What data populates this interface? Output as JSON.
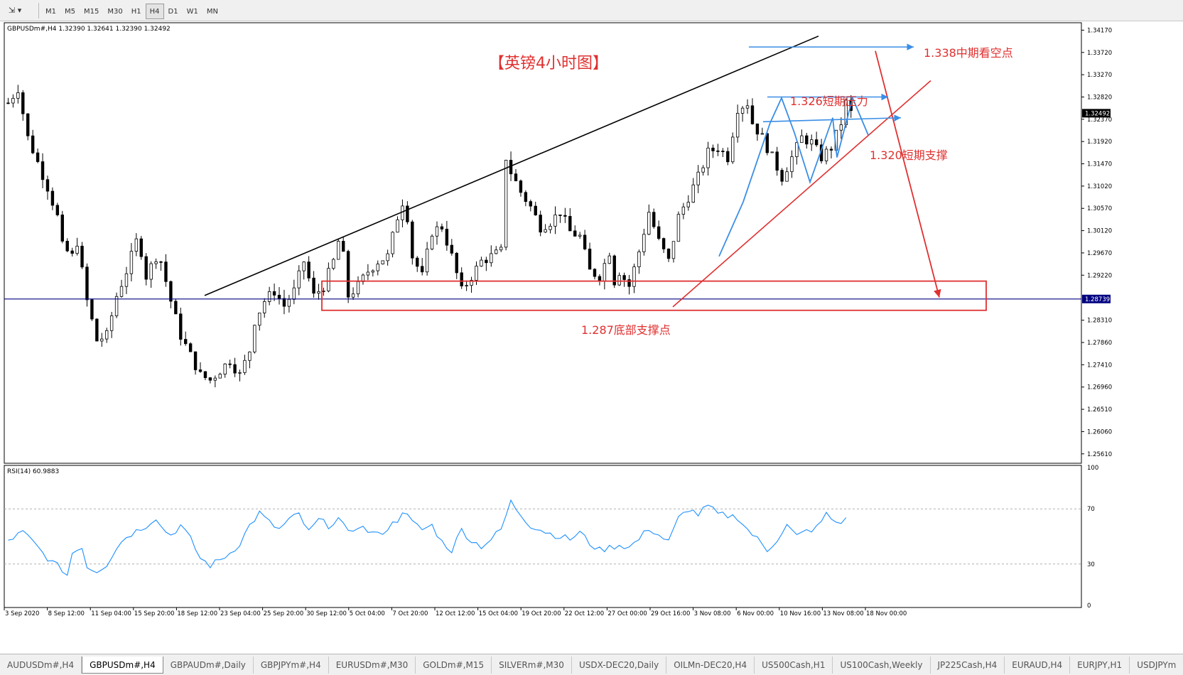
{
  "toolbar": {
    "timeframes": [
      "M1",
      "M5",
      "M15",
      "M30",
      "H1",
      "H4",
      "D1",
      "W1",
      "MN"
    ],
    "active_timeframe": "H4"
  },
  "main_header": "GBPUSDm#,H4  1.32390 1.32641 1.32390 1.32492",
  "rsi_header": "RSI(14) 60.9883",
  "chart_data": {
    "type": "candlestick",
    "symbol": "GBPUSDm#",
    "timeframe": "H4",
    "ohlc_header": {
      "open": 1.3239,
      "high": 1.32641,
      "low": 1.3239,
      "close": 1.32492
    },
    "y_ticks": [
      "1.34170",
      "1.33720",
      "1.33270",
      "1.32820",
      "1.32370",
      "1.31920",
      "1.31470",
      "1.31020",
      "1.30570",
      "1.30120",
      "1.29670",
      "1.29220",
      "1.28310",
      "1.27860",
      "1.27410",
      "1.26960",
      "1.26510",
      "1.26060",
      "1.25610"
    ],
    "ylim": [
      1.2542,
      1.3432
    ],
    "current_price_label": "1.32492",
    "hline_label": "1.28739",
    "hline_value": 1.28739,
    "x_labels": [
      "3 Sep 2020",
      "8 Sep 12:00",
      "11 Sep 04:00",
      "15 Sep 20:00",
      "18 Sep 12:00",
      "23 Sep 04:00",
      "25 Sep 20:00",
      "30 Sep 12:00",
      "5 Oct 04:00",
      "7 Oct 20:00",
      "12 Oct 12:00",
      "15 Oct 04:00",
      "19 Oct 20:00",
      "22 Oct 12:00",
      "27 Oct 00:00",
      "29 Oct 16:00",
      "3 Nov 08:00",
      "6 Nov 00:00",
      "10 Nov 16:00",
      "13 Nov 08:00",
      "18 Nov 00:00"
    ],
    "close_path": [
      [
        0,
        1.327
      ],
      [
        2,
        1.33
      ],
      [
        4,
        1.32
      ],
      [
        6,
        1.315
      ],
      [
        8,
        1.31
      ],
      [
        10,
        1.304
      ],
      [
        11,
        1.298
      ],
      [
        13,
        1.296
      ],
      [
        14,
        1.299
      ],
      [
        16,
        1.287
      ],
      [
        18,
        1.279
      ],
      [
        20,
        1.28
      ],
      [
        22,
        1.288
      ],
      [
        24,
        1.293
      ],
      [
        26,
        1.299
      ],
      [
        27,
        1.297
      ],
      [
        28,
        1.292
      ],
      [
        30,
        1.296
      ],
      [
        31,
        1.295
      ],
      [
        33,
        1.287
      ],
      [
        35,
        1.28
      ],
      [
        37,
        1.276
      ],
      [
        39,
        1.272
      ],
      [
        41,
        1.271
      ],
      [
        43,
        1.273
      ],
      [
        45,
        1.275
      ],
      [
        47,
        1.272
      ],
      [
        49,
        1.277
      ],
      [
        50,
        1.283
      ],
      [
        52,
        1.287
      ],
      [
        54,
        1.289
      ],
      [
        56,
        1.286
      ],
      [
        58,
        1.289
      ],
      [
        60,
        1.295
      ],
      [
        62,
        1.288
      ],
      [
        64,
        1.29
      ],
      [
        66,
        1.295
      ],
      [
        67,
        1.299
      ],
      [
        68,
        1.296
      ],
      [
        69,
        1.288
      ],
      [
        71,
        1.29
      ],
      [
        73,
        1.293
      ],
      [
        75,
        1.295
      ],
      [
        77,
        1.296
      ],
      [
        79,
        1.304
      ],
      [
        80,
        1.307
      ],
      [
        81,
        1.304
      ],
      [
        82,
        1.296
      ],
      [
        84,
        1.292
      ],
      [
        86,
        1.301
      ],
      [
        88,
        1.302
      ],
      [
        90,
        1.296
      ],
      [
        92,
        1.289
      ],
      [
        94,
        1.292
      ],
      [
        96,
        1.295
      ],
      [
        98,
        1.296
      ],
      [
        100,
        1.297
      ],
      [
        101,
        1.316
      ],
      [
        102,
        1.313
      ],
      [
        104,
        1.309
      ],
      [
        106,
        1.306
      ],
      [
        108,
        1.302
      ],
      [
        110,
        1.303
      ],
      [
        112,
        1.305
      ],
      [
        114,
        1.301
      ],
      [
        116,
        1.3
      ],
      [
        118,
        1.293
      ],
      [
        120,
        1.292
      ],
      [
        122,
        1.297
      ],
      [
        123,
        1.291
      ],
      [
        124,
        1.293
      ],
      [
        126,
        1.29
      ],
      [
        128,
        1.297
      ],
      [
        130,
        1.305
      ],
      [
        132,
        1.299
      ],
      [
        134,
        1.295
      ],
      [
        136,
        1.304
      ],
      [
        138,
        1.308
      ],
      [
        140,
        1.312
      ],
      [
        142,
        1.317
      ],
      [
        144,
        1.318
      ],
      [
        146,
        1.316
      ],
      [
        148,
        1.326
      ],
      [
        150,
        1.327
      ],
      [
        151,
        1.323
      ],
      [
        153,
        1.32
      ],
      [
        155,
        1.316
      ],
      [
        157,
        1.312
      ],
      [
        159,
        1.316
      ],
      [
        161,
        1.32
      ],
      [
        163,
        1.319
      ],
      [
        165,
        1.316
      ],
      [
        167,
        1.318
      ],
      [
        169,
        1.323
      ],
      [
        170,
        1.327
      ],
      [
        171,
        1.325
      ]
    ],
    "rsi": {
      "label": "RSI(14)",
      "value": 60.9883,
      "levels": [
        30,
        70
      ],
      "y_ticks": [
        "100",
        "70",
        "30",
        "0"
      ],
      "path": [
        [
          0,
          47
        ],
        [
          3,
          53
        ],
        [
          5,
          46
        ],
        [
          7,
          38
        ],
        [
          9,
          31
        ],
        [
          11,
          26
        ],
        [
          12,
          22
        ],
        [
          13,
          38
        ],
        [
          15,
          43
        ],
        [
          16,
          28
        ],
        [
          18,
          25
        ],
        [
          20,
          30
        ],
        [
          22,
          42
        ],
        [
          24,
          50
        ],
        [
          26,
          54
        ],
        [
          28,
          58
        ],
        [
          30,
          64
        ],
        [
          31,
          57
        ],
        [
          33,
          51
        ],
        [
          35,
          58
        ],
        [
          37,
          48
        ],
        [
          39,
          34
        ],
        [
          41,
          29
        ],
        [
          43,
          33
        ],
        [
          45,
          38
        ],
        [
          47,
          45
        ],
        [
          49,
          58
        ],
        [
          51,
          67
        ],
        [
          53,
          60
        ],
        [
          55,
          55
        ],
        [
          57,
          62
        ],
        [
          59,
          66
        ],
        [
          61,
          53
        ],
        [
          63,
          62
        ],
        [
          65,
          58
        ],
        [
          67,
          63
        ],
        [
          69,
          52
        ],
        [
          71,
          58
        ],
        [
          73,
          54
        ],
        [
          75,
          51
        ],
        [
          77,
          56
        ],
        [
          79,
          62
        ],
        [
          80,
          69
        ],
        [
          82,
          60
        ],
        [
          84,
          55
        ],
        [
          86,
          58
        ],
        [
          88,
          46
        ],
        [
          90,
          40
        ],
        [
          92,
          55
        ],
        [
          94,
          47
        ],
        [
          96,
          43
        ],
        [
          98,
          48
        ],
        [
          100,
          55
        ],
        [
          102,
          75
        ],
        [
          104,
          66
        ],
        [
          106,
          58
        ],
        [
          108,
          55
        ],
        [
          110,
          52
        ],
        [
          112,
          50
        ],
        [
          114,
          48
        ],
        [
          116,
          53
        ],
        [
          118,
          45
        ],
        [
          120,
          40
        ],
        [
          122,
          42
        ],
        [
          124,
          44
        ],
        [
          126,
          42
        ],
        [
          128,
          48
        ],
        [
          130,
          56
        ],
        [
          132,
          51
        ],
        [
          134,
          46
        ],
        [
          136,
          63
        ],
        [
          138,
          70
        ],
        [
          140,
          66
        ],
        [
          142,
          72
        ],
        [
          144,
          66
        ],
        [
          146,
          65
        ],
        [
          148,
          64
        ],
        [
          150,
          55
        ],
        [
          152,
          48
        ],
        [
          154,
          40
        ],
        [
          156,
          48
        ],
        [
          158,
          58
        ],
        [
          160,
          50
        ],
        [
          162,
          54
        ],
        [
          164,
          56
        ],
        [
          166,
          66
        ],
        [
          168,
          60
        ],
        [
          170,
          62
        ]
      ]
    },
    "annotations": {
      "title": "【英镑4小时图】",
      "label_1338": "1.338中期看空点",
      "label_1326": "1.326短期压力",
      "label_1320": "1.320短期支撑",
      "label_1287": "1.287底部支撑点"
    },
    "colors": {
      "bull_candle": "#000000",
      "bear_candle": "#000000",
      "hline": "#000080",
      "rsi_line": "#1e90ff",
      "annotation_red": "#e03030",
      "annotation_blue": "#3a8ee6",
      "trendline": "#000000",
      "current_price_bg": "#000000"
    },
    "grid": false,
    "legend": "none"
  },
  "tabs": {
    "items": [
      "AUDUSDm#,H4",
      "GBPUSDm#,H4",
      "GBPAUDm#,Daily",
      "GBPJPYm#,H4",
      "EURUSDm#,M30",
      "GOLDm#,M15",
      "SILVERm#,M30",
      "USDX-DEC20,Daily",
      "OILMn-DEC20,H4",
      "US500Cash,H1",
      "US100Cash,Weekly",
      "JP225Cash,H4",
      "EURAUD,H4",
      "EURJPY,H1",
      "USDJPYm"
    ],
    "active": "GBPUSDm#,H4"
  }
}
